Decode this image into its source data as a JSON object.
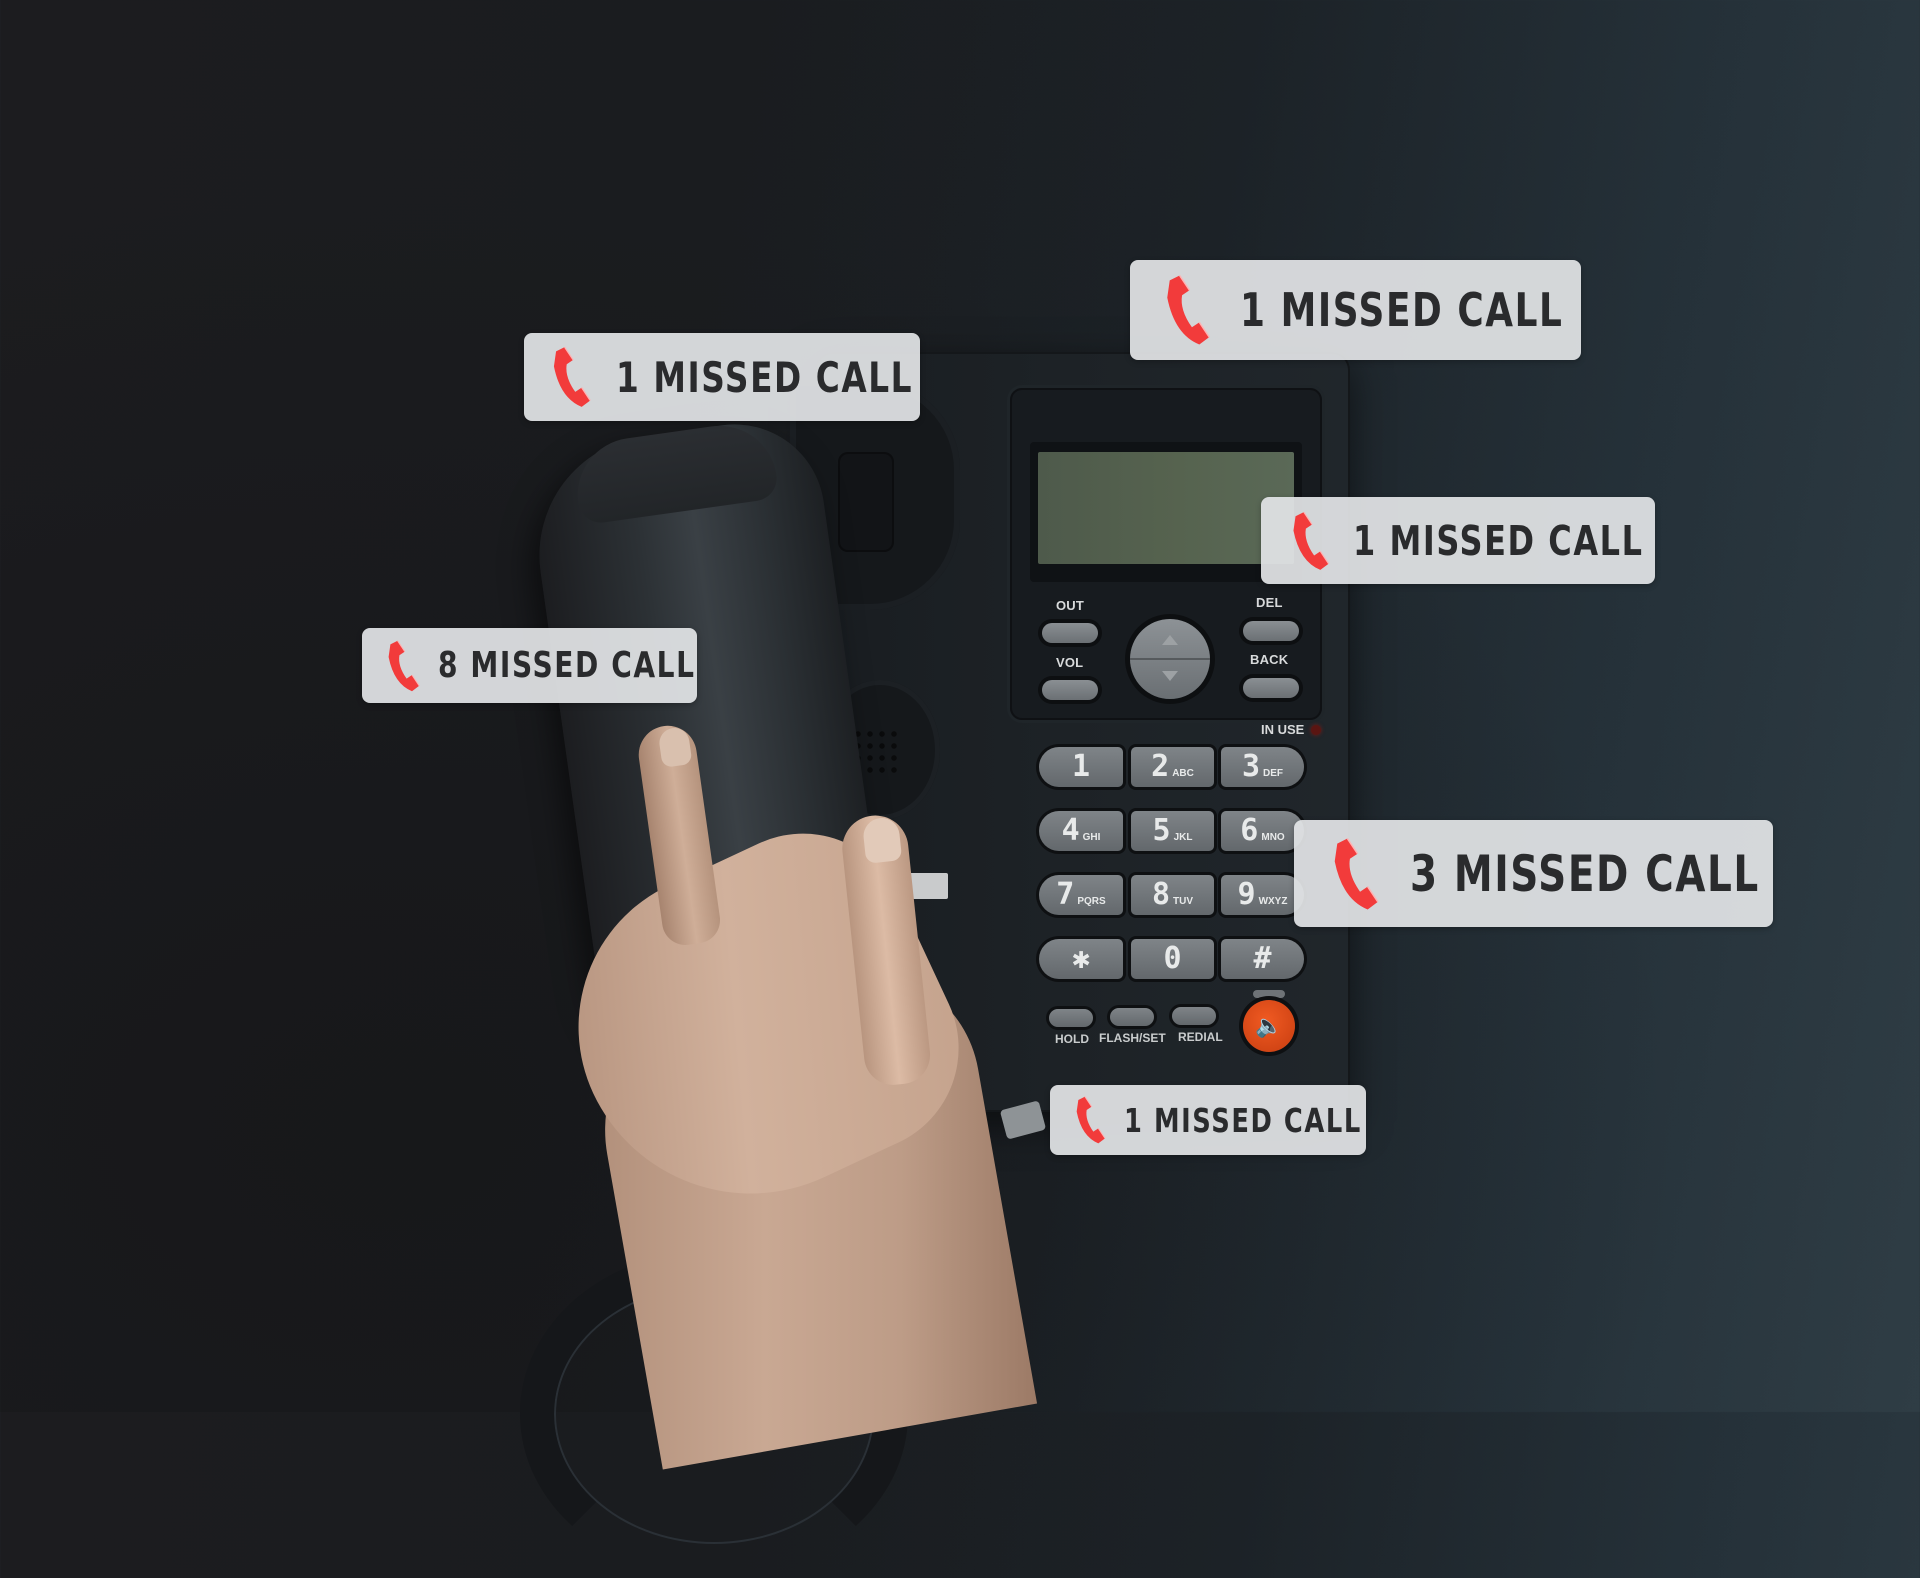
{
  "scene": {
    "description": "Hand lifting the handset of a black desk telephone with missed-call notification badges overlaid",
    "colors": {
      "badge_background": "#e2e4e6",
      "badge_text": "#2a2b2d",
      "phone_icon": "#f23b3b",
      "speaker_button": "#e8501c",
      "lcd": "#56634f"
    }
  },
  "badges": [
    {
      "icon": "missed-call-handset-icon",
      "text": "1 MISSED CALL"
    },
    {
      "icon": "missed-call-handset-icon",
      "text": "1 MISSED CALL"
    },
    {
      "icon": "missed-call-handset-icon",
      "text": "1 MISSED CALL"
    },
    {
      "icon": "missed-call-handset-icon",
      "text": "8 MISSED CALL"
    },
    {
      "icon": "missed-call-handset-icon",
      "text": "3 MISSED CALL"
    },
    {
      "icon": "missed-call-handset-icon",
      "text": "1 MISSED CALL"
    }
  ],
  "phone": {
    "lcd_text": "",
    "soft_keys": {
      "out": "OUT",
      "vol": "VOL",
      "del": "DEL",
      "back": "BACK"
    },
    "in_use_label": "IN USE",
    "keypad": [
      {
        "digit": "1",
        "letters": ""
      },
      {
        "digit": "2",
        "letters": "ABC"
      },
      {
        "digit": "3",
        "letters": "DEF"
      },
      {
        "digit": "4",
        "letters": "GHI"
      },
      {
        "digit": "5",
        "letters": "JKL"
      },
      {
        "digit": "6",
        "letters": "MNO"
      },
      {
        "digit": "7",
        "letters": "PQRS"
      },
      {
        "digit": "8",
        "letters": "TUV"
      },
      {
        "digit": "9",
        "letters": "WXYZ"
      },
      {
        "digit": "✱",
        "letters": ""
      },
      {
        "digit": "0",
        "letters": ""
      },
      {
        "digit": "#",
        "letters": ""
      }
    ],
    "function_keys": {
      "hold": "HOLD",
      "flash": "FLASH/SET",
      "redial": "REDIAL"
    },
    "speaker_icon": "🔈"
  }
}
